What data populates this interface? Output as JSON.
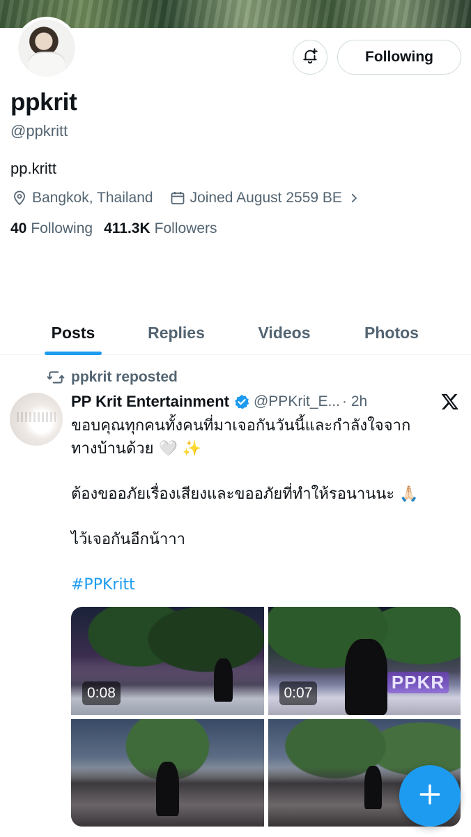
{
  "profile": {
    "display_name": "ppkrit",
    "handle": "@ppkritt",
    "bio": "pp.kritt",
    "location": "Bangkok, Thailand",
    "joined": "Joined August 2559 BE",
    "following_count": "40",
    "following_label": "Following",
    "followers_count": "411.3K",
    "followers_label": "Followers"
  },
  "actions": {
    "follow_label": "Following"
  },
  "tabs": [
    {
      "label": "Posts",
      "active": true
    },
    {
      "label": "Replies",
      "active": false
    },
    {
      "label": "Videos",
      "active": false
    },
    {
      "label": "Photos",
      "active": false
    }
  ],
  "post": {
    "repost_label": "ppkrit reposted",
    "author": "PP Krit Entertainment",
    "author_handle": "@PPKrit_E...",
    "time": "· 2h",
    "lines": [
      "ขอบคุณทุกคนทั้งคนที่มาเจอกันวันนี้และกำลังใจจาก",
      "ทางบ้านด้วย 🤍 ✨",
      "ต้องขออภัยเรื่องเสียงและขออภัยที่ทำให้รอนานนะ 🙏🏻",
      "ไว้เจอกันอีกน้าาา"
    ],
    "hashtag": "#PPKritt",
    "media": [
      {
        "duration": "0:08",
        "type": "video"
      },
      {
        "duration": "0:07",
        "type": "video",
        "sign_text": "PPKR"
      },
      {
        "type": "photo"
      },
      {
        "type": "photo"
      }
    ]
  },
  "colors": {
    "accent": "#1d9bf0",
    "text": "#0f1419",
    "secondary": "#536471",
    "border": "#cfd9de"
  },
  "icons": [
    "bell-plus-icon",
    "location-pin-icon",
    "calendar-icon",
    "chevron-right-icon",
    "repost-icon",
    "verified-badge-icon",
    "x-logo-icon",
    "plus-icon"
  ]
}
